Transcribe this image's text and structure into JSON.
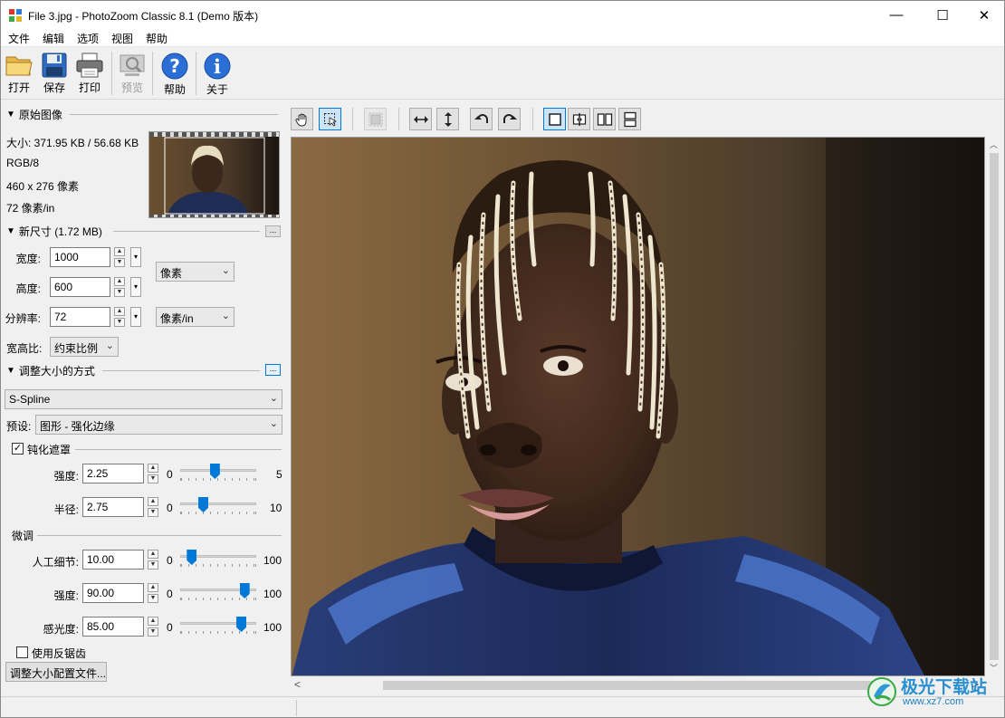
{
  "window": {
    "title": "File 3.jpg - PhotoZoom Classic 8.1 (Demo 版本)",
    "minimize": "—",
    "maximize": "☐",
    "close": "✕"
  },
  "menu": [
    "文件",
    "编辑",
    "选项",
    "视图",
    "帮助"
  ],
  "toolbar": {
    "open": "打开",
    "save": "保存",
    "print": "打印",
    "preview": "预览",
    "help": "帮助",
    "about": "关于"
  },
  "original": {
    "header": "原始图像",
    "size": "大小: 371.95 KB / 56.68 KB",
    "mode": "RGB/8",
    "dims": "460 x 276 像素",
    "res": "72 像素/in"
  },
  "new_size": {
    "header": "新尺寸 (1.72 MB)",
    "more": "...",
    "width_label": "宽度:",
    "width_value": "1000",
    "height_label": "高度:",
    "height_value": "600",
    "res_label": "分辨率:",
    "res_value": "72",
    "size_unit": "像素",
    "res_unit": "像素/in",
    "aspect_label": "宽高比:",
    "aspect_value": "约束比例"
  },
  "method": {
    "header": "调整大小的方式",
    "more": "...",
    "algorithm": "S-Spline",
    "preset_label": "预设:",
    "preset_value": "图形 - 强化边缘"
  },
  "unsharp": {
    "enabled_label": "钝化遮罩",
    "checked_mark": "✓",
    "strength_label": "强度:",
    "strength_value": "2.25",
    "strength_min": "0",
    "strength_max": "5",
    "strength_level": 0.45,
    "radius_label": "半径:",
    "radius_value": "2.75",
    "radius_min": "0",
    "radius_max": "10",
    "radius_level": 0.275
  },
  "finetune": {
    "header": "微调",
    "artifact_label": "人工细节:",
    "artifact_value": "10.00",
    "artifact_min": "0",
    "artifact_max": "100",
    "artifact_level": 0.1,
    "strength_label": "强度:",
    "strength_value": "90.00",
    "strength_min": "0",
    "strength_max": "100",
    "strength_level": 0.9,
    "sensitivity_label": "感光度:",
    "sensitivity_value": "85.00",
    "sensitivity_min": "0",
    "sensitivity_max": "100",
    "sensitivity_level": 0.85
  },
  "antialias_label": "使用反锯齿",
  "profile_button": "调整大小配置文件...",
  "scroll": {
    "up": "︿",
    "down": "﹀",
    "left": "<",
    "right": ">"
  },
  "watermark": {
    "name": "极光下载站",
    "url": "www.xz7.com"
  }
}
